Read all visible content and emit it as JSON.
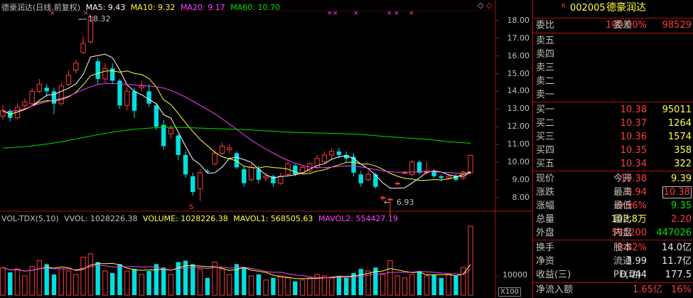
{
  "chart_header": {
    "title": "德豪润达(日线,前复权)",
    "ma5": "MA5: 9.43",
    "ma10": "MA10: 9.32",
    "ma20": "MA20: 9.17",
    "ma60": "MA60: 10.70",
    "high_marker": "18.32",
    "low_marker": "6.93",
    "s_marker": "S"
  },
  "volume_header": {
    "indicator": "VOL-TDX(5,10)",
    "vvol": "VVOL: 1028226.38",
    "volume": "VOLUME: 1028226.38",
    "mavol1": "MAVOL1: 568505.63",
    "mavol2": "MAVOL2: 554427.19"
  },
  "price_axis": [
    "18.00",
    "17.00",
    "16.00",
    "15.00",
    "14.00",
    "13.00",
    "12.00",
    "11.00",
    "10.00",
    "9.00",
    "8.00"
  ],
  "volume_axis": {
    "tick": "10000",
    "unit": "X100"
  },
  "colors": {
    "up": "#ff3c3c",
    "down": "#00e0e0",
    "ma5": "#ffffff",
    "ma10": "#ffff40",
    "ma20": "#ff40ff",
    "ma60": "#00e000"
  },
  "chart_data": {
    "type": "candlestick",
    "ylim": [
      7.5,
      18.6
    ],
    "candles": [
      {
        "o": 12.6,
        "c": 12.9,
        "h": 13.2,
        "l": 12.4
      },
      {
        "o": 12.9,
        "c": 12.5,
        "h": 13.0,
        "l": 12.3
      },
      {
        "o": 12.5,
        "c": 13.1,
        "h": 13.3,
        "l": 12.4
      },
      {
        "o": 13.2,
        "c": 13.4,
        "h": 13.6,
        "l": 13.0
      },
      {
        "o": 13.3,
        "c": 14.0,
        "h": 14.2,
        "l": 13.2
      },
      {
        "o": 14.0,
        "c": 14.4,
        "h": 14.7,
        "l": 13.9
      },
      {
        "o": 14.2,
        "c": 14.0,
        "h": 14.4,
        "l": 13.7
      },
      {
        "o": 14.0,
        "c": 13.3,
        "h": 14.2,
        "l": 12.7
      },
      {
        "o": 13.3,
        "c": 14.3,
        "h": 14.5,
        "l": 13.2
      },
      {
        "o": 14.4,
        "c": 14.9,
        "h": 15.2,
        "l": 14.3
      },
      {
        "o": 15.2,
        "c": 15.6,
        "h": 15.8,
        "l": 15.0
      },
      {
        "o": 16.2,
        "c": 16.7,
        "h": 17.1,
        "l": 16.1
      },
      {
        "o": 16.8,
        "c": 18.2,
        "h": 18.32,
        "l": 16.7
      },
      {
        "o": 15.7,
        "c": 14.7,
        "h": 15.9,
        "l": 14.4
      },
      {
        "o": 14.7,
        "c": 15.3,
        "h": 15.6,
        "l": 14.5
      },
      {
        "o": 15.3,
        "c": 14.6,
        "h": 15.6,
        "l": 14.4
      },
      {
        "o": 14.6,
        "c": 13.2,
        "h": 14.7,
        "l": 13.0
      },
      {
        "o": 13.2,
        "c": 14.0,
        "h": 14.2,
        "l": 12.9
      },
      {
        "o": 14.0,
        "c": 12.9,
        "h": 14.2,
        "l": 12.5
      },
      {
        "o": 14.2,
        "c": 14.3,
        "h": 14.6,
        "l": 14.0
      },
      {
        "o": 14.0,
        "c": 13.3,
        "h": 14.4,
        "l": 13.1
      },
      {
        "o": 13.2,
        "c": 12.0,
        "h": 13.3,
        "l": 11.8
      },
      {
        "o": 12.1,
        "c": 10.9,
        "h": 12.4,
        "l": 10.7
      },
      {
        "o": 11.6,
        "c": 11.9,
        "h": 12.1,
        "l": 11.3
      },
      {
        "o": 11.5,
        "c": 10.4,
        "h": 11.6,
        "l": 10.1
      },
      {
        "o": 10.4,
        "c": 9.3,
        "h": 10.6,
        "l": 9.1
      },
      {
        "o": 9.2,
        "c": 8.3,
        "h": 9.4,
        "l": 8.1
      },
      {
        "o": 8.5,
        "c": 9.4,
        "h": 9.6,
        "l": 7.8
      },
      {
        "o": 9.5,
        "c": 9.45,
        "h": 9.6,
        "l": 9.35
      },
      {
        "o": 9.9,
        "c": 10.5,
        "h": 10.7,
        "l": 9.8
      },
      {
        "o": 10.5,
        "c": 10.9,
        "h": 11.1,
        "l": 10.4
      },
      {
        "o": 10.7,
        "c": 10.8,
        "h": 11.0,
        "l": 10.5
      },
      {
        "o": 10.5,
        "c": 9.7,
        "h": 10.6,
        "l": 9.6
      },
      {
        "o": 9.6,
        "c": 8.8,
        "h": 9.8,
        "l": 8.6
      },
      {
        "o": 9.0,
        "c": 9.7,
        "h": 9.9,
        "l": 8.9
      },
      {
        "o": 9.6,
        "c": 9.0,
        "h": 9.8,
        "l": 8.8
      },
      {
        "o": 9.1,
        "c": 9.2,
        "h": 9.4,
        "l": 8.9
      },
      {
        "o": 9.2,
        "c": 8.8,
        "h": 9.3,
        "l": 8.6
      },
      {
        "o": 8.8,
        "c": 9.2,
        "h": 9.4,
        "l": 8.7
      },
      {
        "o": 9.3,
        "c": 9.9,
        "h": 10.0,
        "l": 9.2
      },
      {
        "o": 9.8,
        "c": 9.3,
        "h": 9.9,
        "l": 9.2
      },
      {
        "o": 9.4,
        "c": 9.7,
        "h": 9.8,
        "l": 9.3
      },
      {
        "o": 9.5,
        "c": 9.9,
        "h": 10.0,
        "l": 9.4
      },
      {
        "o": 9.7,
        "c": 10.2,
        "h": 10.4,
        "l": 9.6
      },
      {
        "o": 10.0,
        "c": 10.4,
        "h": 10.6,
        "l": 9.9
      },
      {
        "o": 10.4,
        "c": 10.6,
        "h": 10.8,
        "l": 10.2
      },
      {
        "o": 10.6,
        "c": 10.4,
        "h": 10.8,
        "l": 10.2
      },
      {
        "o": 10.4,
        "c": 10.2,
        "h": 10.6,
        "l": 10.0
      },
      {
        "o": 10.3,
        "c": 9.4,
        "h": 10.5,
        "l": 9.2
      },
      {
        "o": 9.3,
        "c": 8.8,
        "h": 9.5,
        "l": 8.6
      },
      {
        "o": 9.0,
        "c": 9.3,
        "h": 9.5,
        "l": 8.9
      },
      {
        "o": 9.3,
        "c": 8.6,
        "h": 9.4,
        "l": 8.5
      },
      {
        "o": 8.0,
        "c": 8.0,
        "h": 8.1,
        "l": 7.8
      },
      {
        "o": 7.9,
        "c": 7.9,
        "h": 8.0,
        "l": 6.93
      },
      {
        "o": 8.8,
        "c": 8.8,
        "h": 8.9,
        "l": 8.7
      },
      {
        "o": 9.4,
        "c": 9.4,
        "h": 9.5,
        "l": 9.3
      },
      {
        "o": 9.3,
        "c": 10.0,
        "h": 10.1,
        "l": 9.2
      },
      {
        "o": 10.0,
        "c": 9.4,
        "h": 10.1,
        "l": 9.3
      },
      {
        "o": 9.4,
        "c": 9.5,
        "h": 10.0,
        "l": 9.3
      },
      {
        "o": 9.5,
        "c": 9.2,
        "h": 9.6,
        "l": 9.1
      },
      {
        "o": 9.2,
        "c": 9.1,
        "h": 9.3,
        "l": 8.9
      },
      {
        "o": 9.1,
        "c": 9.2,
        "h": 9.3,
        "l": 9.0
      },
      {
        "o": 9.2,
        "c": 9.0,
        "h": 9.3,
        "l": 8.9
      },
      {
        "o": 9.1,
        "c": 9.44,
        "h": 9.5,
        "l": 9.0
      },
      {
        "o": 9.39,
        "c": 10.38,
        "h": 10.38,
        "l": 9.35
      }
    ],
    "volumes": [
      0.4,
      0.33,
      0.38,
      0.28,
      0.42,
      0.5,
      0.45,
      0.3,
      0.38,
      0.35,
      0.3,
      0.55,
      0.6,
      0.48,
      0.35,
      0.32,
      0.45,
      0.35,
      0.38,
      0.3,
      0.35,
      0.45,
      0.4,
      0.3,
      0.48,
      0.5,
      0.45,
      0.38,
      0.25,
      0.48,
      0.38,
      0.3,
      0.45,
      0.4,
      0.28,
      0.3,
      0.22,
      0.25,
      0.28,
      0.25,
      0.2,
      0.22,
      0.25,
      0.3,
      0.28,
      0.25,
      0.28,
      0.25,
      0.32,
      0.38,
      0.35,
      0.4,
      0.3,
      0.5,
      0.28,
      0.25,
      0.3,
      0.35,
      0.28,
      0.3,
      0.25,
      0.3,
      0.28,
      0.4,
      1.0
    ]
  },
  "panel": {
    "code_flag": "R",
    "code": "002005",
    "name": "德豪润达",
    "weibi_label": "委比",
    "weibi_value": "100.00%",
    "weicha_label": "委差",
    "weicha_value": "98529",
    "sell": [
      {
        "label": "卖五",
        "price": "",
        "vol": ""
      },
      {
        "label": "卖四",
        "price": "",
        "vol": ""
      },
      {
        "label": "卖三",
        "price": "",
        "vol": ""
      },
      {
        "label": "卖二",
        "price": "",
        "vol": ""
      },
      {
        "label": "卖一",
        "price": "",
        "vol": ""
      }
    ],
    "buy": [
      {
        "label": "买一",
        "price": "10.38",
        "vol": "95011"
      },
      {
        "label": "买二",
        "price": "10.37",
        "vol": "1264"
      },
      {
        "label": "买三",
        "price": "10.36",
        "vol": "1574"
      },
      {
        "label": "买四",
        "price": "10.35",
        "vol": "358"
      },
      {
        "label": "买五",
        "price": "10.34",
        "vol": "322"
      }
    ],
    "quote": [
      {
        "l1": "现价",
        "v1": "10.38",
        "l2": "今开",
        "v2": "9.39"
      },
      {
        "l1": "涨跌",
        "v1": "0.94",
        "l2": "最高",
        "v2": "10.38"
      },
      {
        "l1": "涨幅",
        "v1": "9.96%",
        "l2": "最低",
        "v2": "9.35"
      },
      {
        "l1": "总量",
        "v1": "102.8万",
        "l2": "量比",
        "v2": "2.20"
      },
      {
        "l1": "外盘",
        "v1": "581200",
        "l2": "内盘",
        "v2": "447026"
      }
    ],
    "fund": [
      {
        "l1": "换手",
        "v1": "8.82%",
        "l2": "股本",
        "v2": "14.0亿"
      },
      {
        "l1": "净资",
        "v1": "3.99",
        "l2": "流通",
        "v2": "11.7亿"
      },
      {
        "l1": "收益(三)",
        "v1": "0.044",
        "l2": "PE(动)",
        "v2": "177.5"
      }
    ],
    "netflow_label": "净流入额",
    "netflow_value": "1.65亿",
    "netflow_pct": "16%"
  }
}
